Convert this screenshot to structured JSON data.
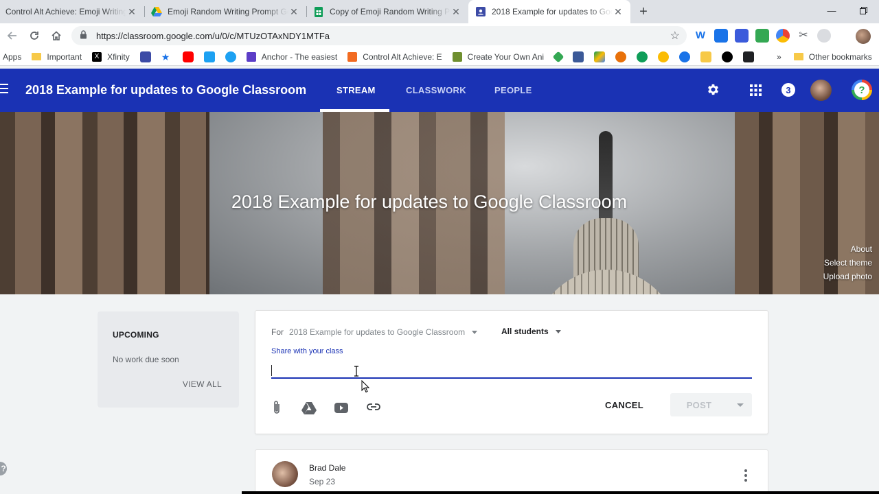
{
  "browser": {
    "tabs": [
      {
        "title": "Control Alt Achieve: Emoji Writing",
        "favicon_color": "#e8710a"
      },
      {
        "title": "Emoji Random Writing Prompt Generator",
        "favicon_color": "#1a73e8"
      },
      {
        "title": "Copy of Emoji Random Writing Prompts",
        "favicon_color": "#0f9d58"
      },
      {
        "title": "2018 Example for updates to Google Classroom",
        "favicon_color": "#3c4ba6"
      }
    ],
    "url": "https://classroom.google.com/u/0/c/MTUzOTAxNDY1MTFa",
    "bookmarks": [
      {
        "label": "Apps",
        "kind": "text"
      },
      {
        "label": "Important",
        "kind": "folder"
      },
      {
        "label": "Xfinity",
        "kind": "icon",
        "color": "#000000"
      },
      {
        "label": "Anchor - The easiest",
        "kind": "icon",
        "color": "#5c3ec7"
      },
      {
        "label": "Control Alt Achieve: E",
        "kind": "icon",
        "color": "#f26b21"
      },
      {
        "label": "Create Your Own Ani",
        "kind": "icon",
        "color": "#6f8f2f"
      },
      {
        "label": "Other bookmarks",
        "kind": "folder"
      }
    ],
    "more_bookmarks": "»"
  },
  "header": {
    "class_title": "2018 Example for updates to Google Classroom",
    "tabs": [
      {
        "label": "STREAM",
        "active": true
      },
      {
        "label": "CLASSWORK",
        "active": false
      },
      {
        "label": "PEOPLE",
        "active": false
      }
    ],
    "notification_count": "3"
  },
  "banner": {
    "title": "2018 Example for updates to Google Classroom",
    "links": [
      "About",
      "Select theme",
      "Upload photo"
    ]
  },
  "upcoming": {
    "title": "UPCOMING",
    "empty_text": "No work due soon",
    "view_all": "VIEW ALL"
  },
  "composer": {
    "for_label": "For",
    "class_select": "2018 Example for updates to Google Classroom",
    "audience_select": "All students",
    "share_label": "Share with your class",
    "input_value": "",
    "cancel_label": "CANCEL",
    "post_label": "POST"
  },
  "stream_post": {
    "author": "Brad Dale",
    "date": "Sep 23"
  },
  "colors": {
    "brand_blue": "#1a32b4",
    "page_bg": "#f1f3f4"
  }
}
